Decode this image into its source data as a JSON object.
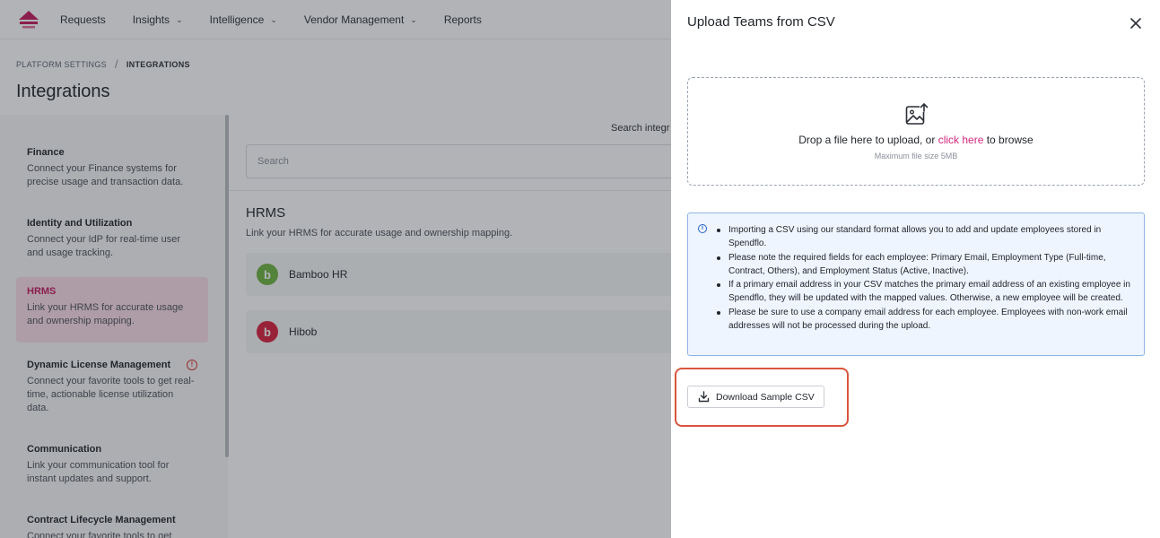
{
  "nav": {
    "items": [
      {
        "label": "Requests",
        "dropdown": false
      },
      {
        "label": "Insights",
        "dropdown": true
      },
      {
        "label": "Intelligence",
        "dropdown": true
      },
      {
        "label": "Vendor Management",
        "dropdown": true
      },
      {
        "label": "Reports",
        "dropdown": false
      }
    ]
  },
  "breadcrumb": {
    "parent": "PLATFORM SETTINGS",
    "separator": "/",
    "current": "INTEGRATIONS"
  },
  "page_title": "Integrations",
  "sidebar": {
    "items": [
      {
        "title": "Finance",
        "desc": "Connect your Finance systems for precise usage and transaction data."
      },
      {
        "title": "Identity and Utilization",
        "desc": "Connect your IdP for real-time user and usage tracking."
      },
      {
        "title": "HRMS",
        "desc": "Link your HRMS for accurate usage and ownership mapping.",
        "active": true
      },
      {
        "title": "Dynamic License Management",
        "desc": "Connect your favorite tools to get real-time, actionable license utilization data.",
        "warning": true
      },
      {
        "title": "Communication",
        "desc": "Link your communication tool for instant updates and support."
      },
      {
        "title": "Contract Lifecycle Management",
        "desc": "Connect your favorite tools to get"
      }
    ]
  },
  "main": {
    "search_label": "Search integr",
    "search_placeholder": "Search",
    "section_title": "HRMS",
    "section_desc": "Link your HRMS for accurate usage and ownership mapping.",
    "integrations": [
      {
        "name": "Bamboo HR",
        "icon": "bamboo-icon",
        "color": "#6cb33f"
      },
      {
        "name": "Hibob",
        "icon": "hibob-icon",
        "color": "#d81f3a"
      }
    ]
  },
  "drawer": {
    "title": "Upload Teams from CSV",
    "drop_text_before": "Drop a file here to upload, or ",
    "drop_link": "click here",
    "drop_text_after": " to browse",
    "drop_hint": "Maximum file size 5MB",
    "info_items": [
      "Importing a CSV using our standard format allows you to add and update employees stored in Spendflo.",
      "Please note the required fields for each employee: Primary Email, Employment Type (Full-time, Contract, Others), and Employment Status (Active, Inactive).",
      "If a primary email address in your CSV matches the primary email address of an existing employee in Spendflo, they will be updated with the mapped values. Otherwise, a new employee will be created.",
      "Please be sure to use a company email address for each employee. Employees with non-work email addresses will not be processed during the upload."
    ],
    "download_label": "Download Sample CSV"
  },
  "colors": {
    "brand": "#c2185b",
    "link": "#d2287f",
    "highlight": "#d9553d",
    "info_border": "#90b4e6"
  }
}
